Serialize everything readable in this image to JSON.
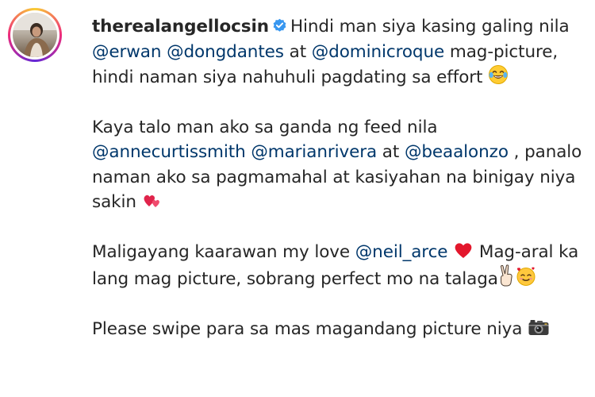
{
  "post": {
    "username": "therealangellocsin",
    "verified_icon": "verified-badge-icon",
    "avatar_icon": "profile-avatar",
    "accent_color": "#3897f0",
    "link_color": "#00376b",
    "caption": {
      "p1": {
        "t1": "Hindi man siya kasing galing nila ",
        "m1": "@erwan",
        "t2": " ",
        "m2": "@dongdantes",
        "t3": " at ",
        "m3": "@dominicroque",
        "t4": " mag-picture, hindi naman siya nahuhuli pagdating sa effort ",
        "emoji": "laughing-crying-emoji"
      },
      "p2": {
        "t1": "Kaya talo man ako sa ganda ng feed nila ",
        "m1": "@annecurtissmith",
        "t2": " ",
        "m2": "@marianrivera",
        "t3": " at ",
        "m3": "@beaalonzo",
        "t4": " , panalo naman ako sa pagmamahal at kasiyahan na binigay niya sakin ",
        "emoji": "two-hearts-emoji"
      },
      "p3": {
        "t1": "Maligayang kaarawan my love ",
        "m1": "@neil_arce",
        "t2": " Mag-aral ka lang mag picture, sobrang perfect mo na talaga",
        "emoji1": "heart-emoji",
        "emoji2": "victory-hand-emoji",
        "emoji3": "smiling-face-with-hearts-emoji"
      },
      "p4": {
        "t1": "Please swipe para sa mas magandang picture niya ",
        "emoji": "camera-emoji"
      }
    }
  }
}
